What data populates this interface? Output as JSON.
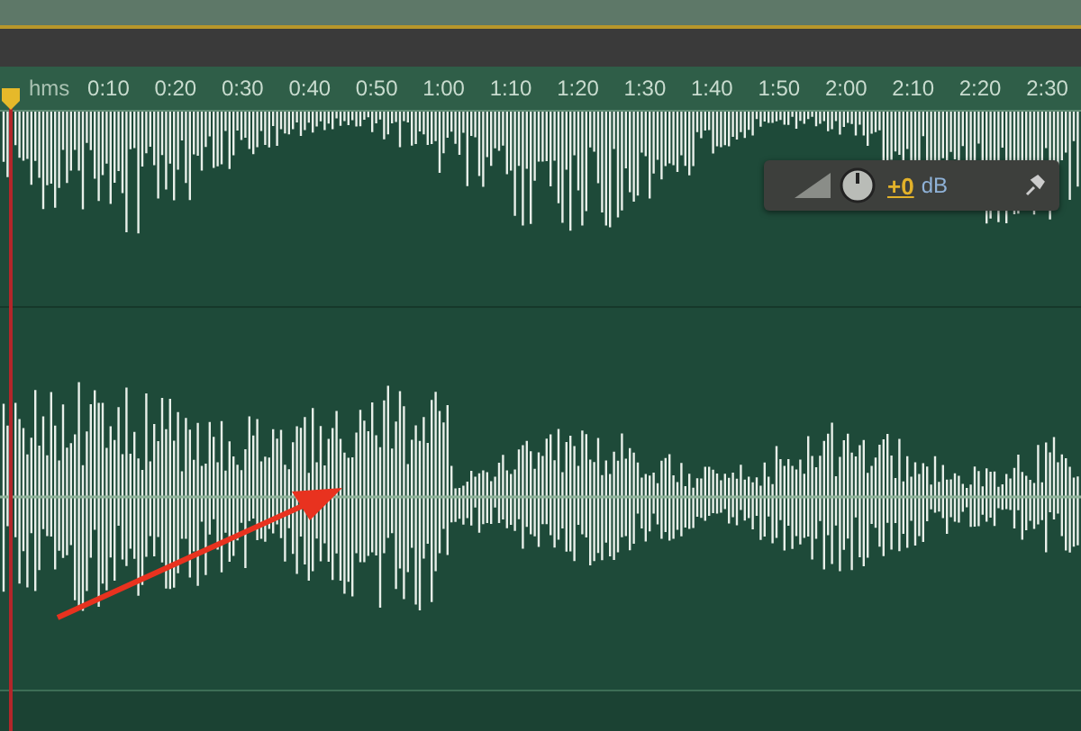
{
  "ruler": {
    "unit": "hms",
    "ticks": [
      "0:10",
      "0:20",
      "0:30",
      "0:40",
      "0:50",
      "1:00",
      "1:10",
      "1:20",
      "1:30",
      "1:40",
      "1:50",
      "2:00",
      "2:10",
      "2:20",
      "2:30"
    ]
  },
  "hud": {
    "gain": "+0",
    "unit": "dB"
  }
}
